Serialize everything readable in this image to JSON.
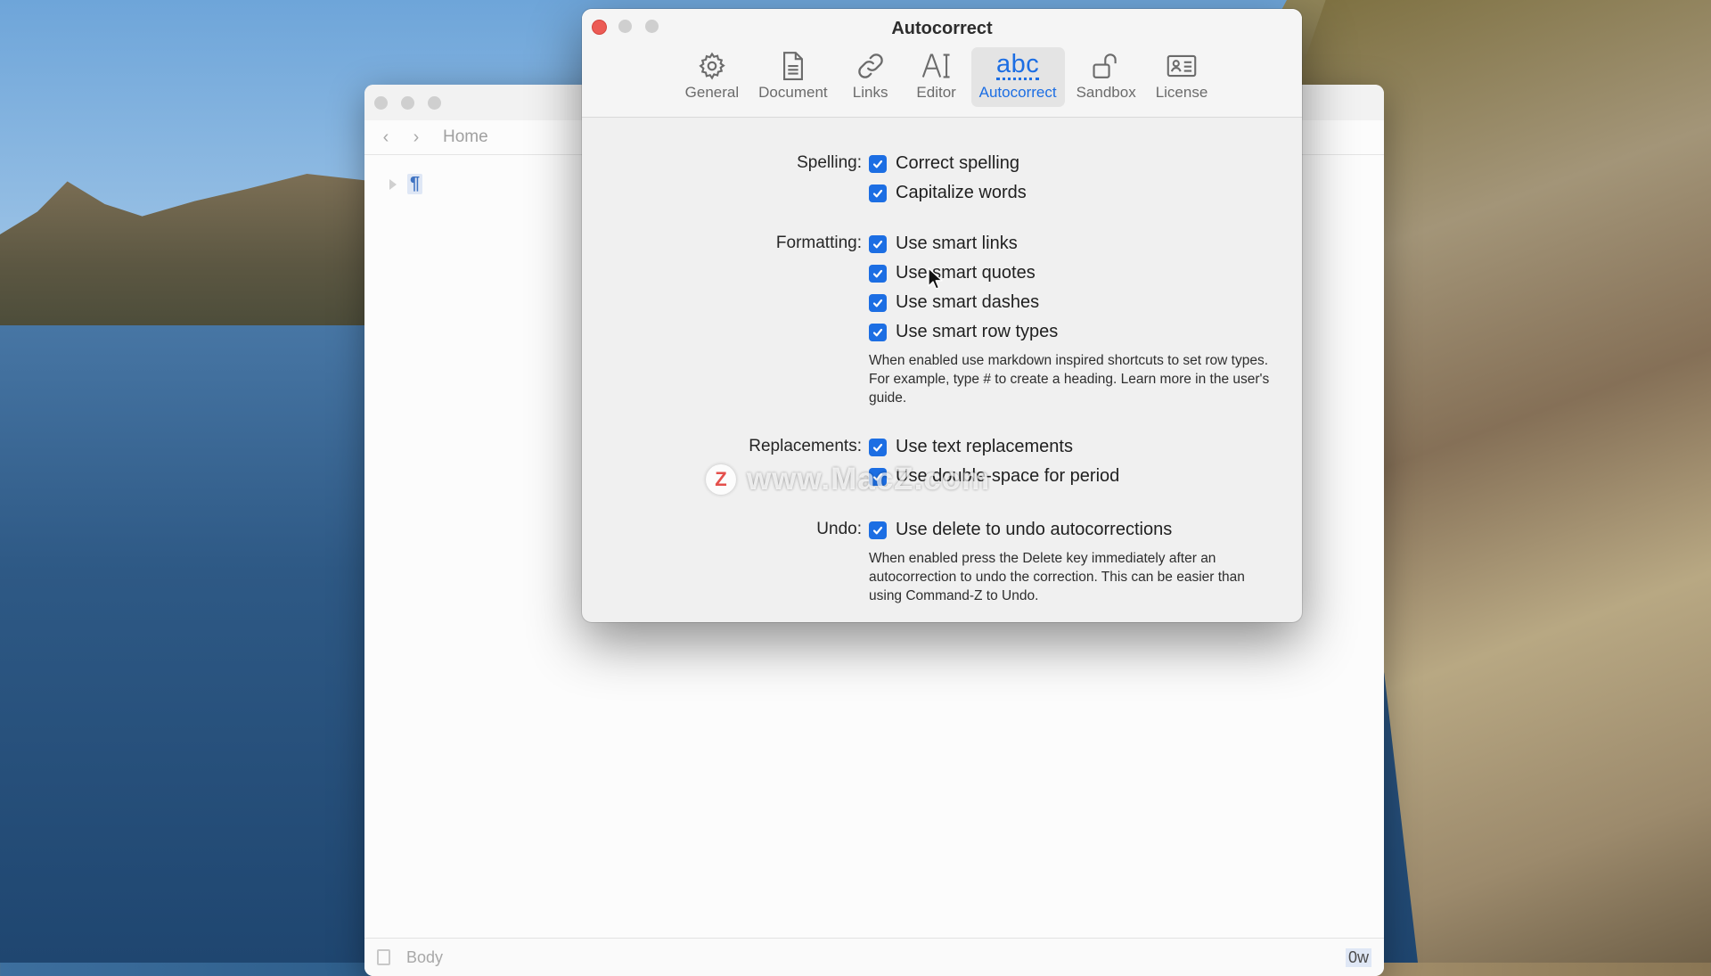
{
  "app_window": {
    "breadcrumb": "Home",
    "back_icon": "chevron-left-icon",
    "forward_icon": "chevron-right-icon",
    "row_marker": "¶",
    "status_style": "Body",
    "word_count": "0w"
  },
  "prefs": {
    "title": "Autocorrect",
    "tabs": [
      {
        "label": "General",
        "icon": "gear-icon"
      },
      {
        "label": "Document",
        "icon": "document-icon"
      },
      {
        "label": "Links",
        "icon": "link-icon"
      },
      {
        "label": "Editor",
        "icon": "text-cursor-icon"
      },
      {
        "label": "Autocorrect",
        "icon": "abc-icon",
        "active": true
      },
      {
        "label": "Sandbox",
        "icon": "unlock-icon"
      },
      {
        "label": "License",
        "icon": "id-card-icon"
      }
    ],
    "abc_glyph": "abc",
    "spelling": {
      "label": "Spelling:",
      "options": [
        {
          "label": "Correct spelling",
          "checked": true
        },
        {
          "label": "Capitalize words",
          "checked": true
        }
      ]
    },
    "formatting": {
      "label": "Formatting:",
      "options": [
        {
          "label": "Use smart links",
          "checked": true
        },
        {
          "label": "Use smart quotes",
          "checked": true
        },
        {
          "label": "Use smart dashes",
          "checked": true
        },
        {
          "label": "Use smart row types",
          "checked": true
        }
      ],
      "note": "When enabled use markdown inspired shortcuts to set row types. For example, type # to create a heading. Learn more in the user's guide."
    },
    "replacements": {
      "label": "Replacements:",
      "options": [
        {
          "label": "Use text replacements",
          "checked": true
        },
        {
          "label": "Use double-space for period",
          "checked": true
        }
      ]
    },
    "undo": {
      "label": "Undo:",
      "options": [
        {
          "label": "Use delete to undo autocorrections",
          "checked": true
        }
      ],
      "note": "When enabled press the Delete key immediately after an autocorrection to undo the correction. This can be easier than using Command-Z to Undo."
    }
  },
  "watermark": {
    "logo_letter": "Z",
    "text": "www.MacZ.com"
  },
  "colors": {
    "accent": "#1c6ee3",
    "close_button": "#ec5b55"
  }
}
